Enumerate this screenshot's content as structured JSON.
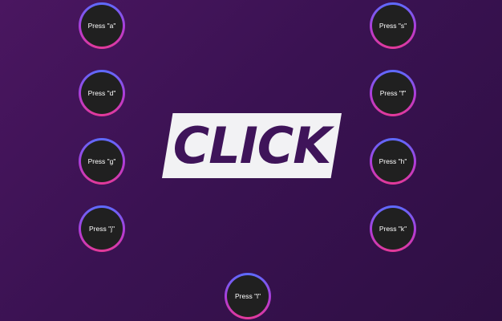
{
  "logo": {
    "text": "CLICK"
  },
  "keys": [
    {
      "label": "Press \"a\""
    },
    {
      "label": "Press \"s\""
    },
    {
      "label": "Press \"d\""
    },
    {
      "label": "Press \"f\""
    },
    {
      "label": "Press \"g\""
    },
    {
      "label": "Press \"h\""
    },
    {
      "label": "Press \"j\""
    },
    {
      "label": "Press \"k\""
    },
    {
      "label": "Press \"l\""
    }
  ],
  "colors": {
    "background_start": "#4a1660",
    "background_end": "#2e0f43",
    "button_face": "#202020",
    "ring_top": "#5b6cff",
    "ring_bottom": "#e43a97",
    "logo_plate": "#f2f2f4",
    "logo_text": "#3f145a"
  }
}
